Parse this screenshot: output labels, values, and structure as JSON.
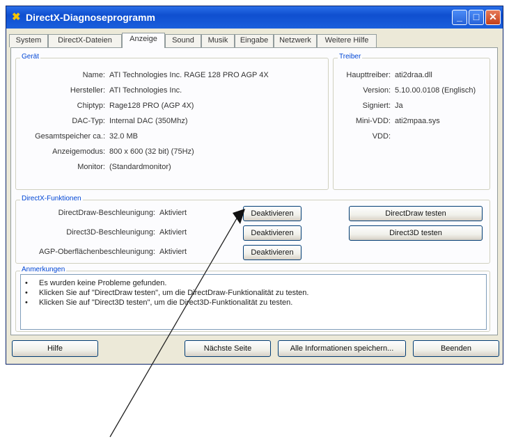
{
  "window": {
    "title": "DirectX-Diagnoseprogramm",
    "minimize_glyph": "_",
    "maximize_glyph": "□",
    "close_glyph": "✕",
    "title_icon": "✖"
  },
  "tabs": [
    "System",
    "DirectX-Dateien",
    "Anzeige",
    "Sound",
    "Musik",
    "Eingabe",
    "Netzwerk",
    "Weitere Hilfe"
  ],
  "active_tab": "Anzeige",
  "device": {
    "group_title": "Gerät",
    "rows": [
      {
        "label": "Name:",
        "value": "ATI Technologies Inc. RAGE 128 PRO AGP 4X"
      },
      {
        "label": "Hersteller:",
        "value": "ATI Technologies Inc."
      },
      {
        "label": "Chiptyp:",
        "value": "Rage128 PRO (AGP 4X)"
      },
      {
        "label": "DAC-Typ:",
        "value": "Internal DAC (350Mhz)"
      },
      {
        "label": "Gesamtspeicher ca.:",
        "value": "32.0 MB"
      },
      {
        "label": "Anzeigemodus:",
        "value": "800 x 600 (32 bit) (75Hz)"
      },
      {
        "label": "Monitor:",
        "value": "(Standardmonitor)"
      }
    ]
  },
  "driver": {
    "group_title": "Treiber",
    "rows": [
      {
        "label": "Haupttreiber:",
        "value": "ati2draa.dll"
      },
      {
        "label": "Version:",
        "value": "5.10.00.0108 (Englisch)"
      },
      {
        "label": "Signiert:",
        "value": "Ja"
      },
      {
        "label": "Mini-VDD:",
        "value": "ati2mpaa.sys"
      },
      {
        "label": "VDD:",
        "value": ""
      }
    ]
  },
  "features": {
    "group_title": "DirectX-Funktionen",
    "rows": [
      {
        "label": "DirectDraw-Beschleunigung:",
        "status": "Aktiviert",
        "button": "Deaktivieren"
      },
      {
        "label": "Direct3D-Beschleunigung:",
        "status": "Aktiviert",
        "button": "Deaktivieren"
      },
      {
        "label": "AGP-Oberflächenbeschleunigung:",
        "status": "Aktiviert",
        "button": "Deaktivieren"
      }
    ],
    "test_directdraw": "DirectDraw testen",
    "test_direct3d": "Direct3D testen"
  },
  "notes": {
    "group_title": "Anmerkungen",
    "bullet": "•",
    "lines": [
      "Es wurden keine Probleme gefunden.",
      "Klicken Sie auf \"DirectDraw testen\", um die DirectDraw-Funktionalität zu testen.",
      "Klicken Sie auf \"Direct3D testen\", um die Direct3D-Funktionalität zu testen."
    ]
  },
  "footer": {
    "help": "Hilfe",
    "next_page": "Nächste Seite",
    "save_all": "Alle Informationen speichern...",
    "exit": "Beenden"
  }
}
